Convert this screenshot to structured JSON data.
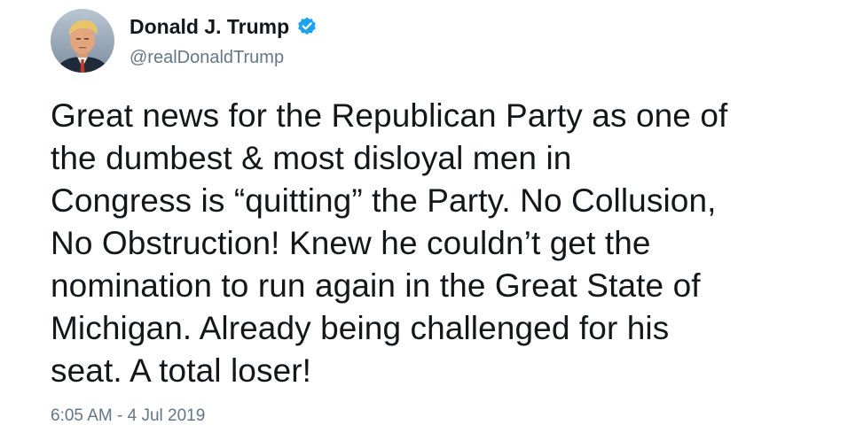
{
  "tweet": {
    "author": {
      "display_name": "Donald J. Trump",
      "handle": "@realDonaldTrump",
      "avatar_icon": "profile-photo-avatar",
      "verified_icon": "verified-badge-icon",
      "verified_color": "#1da1f2"
    },
    "text_lines": [
      "Great news for the Republican Party as one of",
      "the dumbest & most disloyal men in",
      "Congress is “quitting” the Party. No Collusion,",
      "No Obstruction! Knew he couldn’t get the",
      "nomination to run again in the Great State of",
      "Michigan. Already being challenged for his",
      "seat. A total loser!"
    ],
    "timestamp": "6:05 AM - 4 Jul 2019"
  },
  "colors": {
    "text": "#14171a",
    "secondary_text": "#657786",
    "background": "#ffffff"
  }
}
